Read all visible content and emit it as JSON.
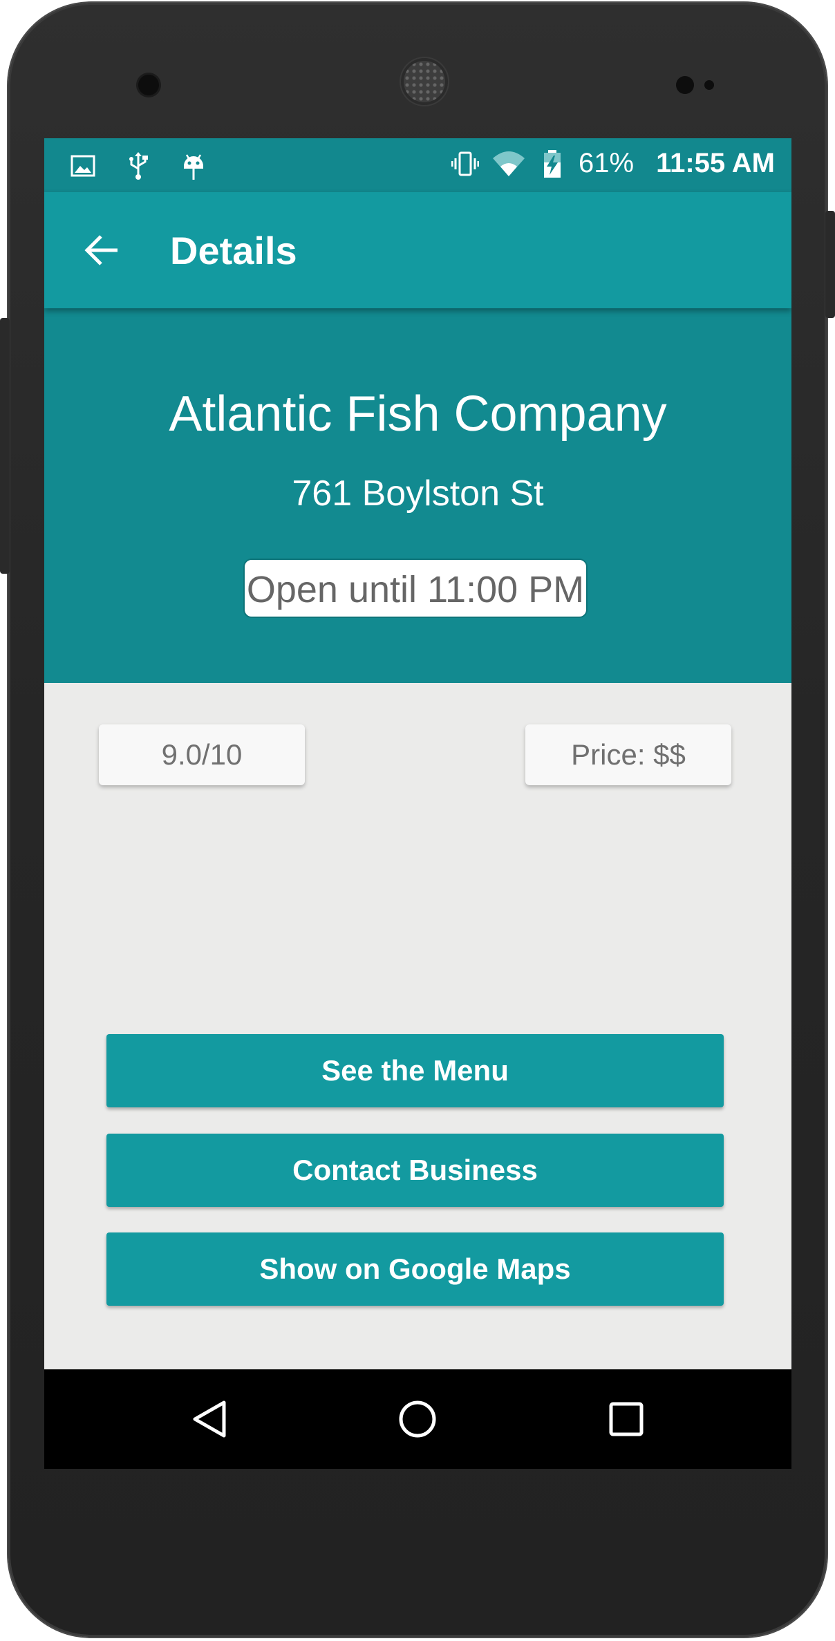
{
  "statusbar": {
    "icons": [
      "image-icon",
      "usb-icon",
      "android-icon",
      "vibrate-icon",
      "wifi-icon",
      "battery-charging-icon"
    ],
    "battery": "61%",
    "time": "11:55 AM"
  },
  "toolbar": {
    "back_icon": "back-arrow-icon",
    "title": "Details"
  },
  "business": {
    "name": "Atlantic Fish Company",
    "address": "761 Boylston St",
    "hours": "Open until 11:00 PM",
    "rating": "9.0/10",
    "price": "Price: $$"
  },
  "actions": {
    "menu": "See the Menu",
    "contact": "Contact Business",
    "maps": "Show on Google Maps"
  },
  "navbar": {
    "icons": [
      "nav-back-icon",
      "nav-home-icon",
      "nav-recents-icon"
    ]
  },
  "colors": {
    "primary": "#139aa0",
    "primary_dark": "#12888e",
    "background": "#ebebea"
  }
}
